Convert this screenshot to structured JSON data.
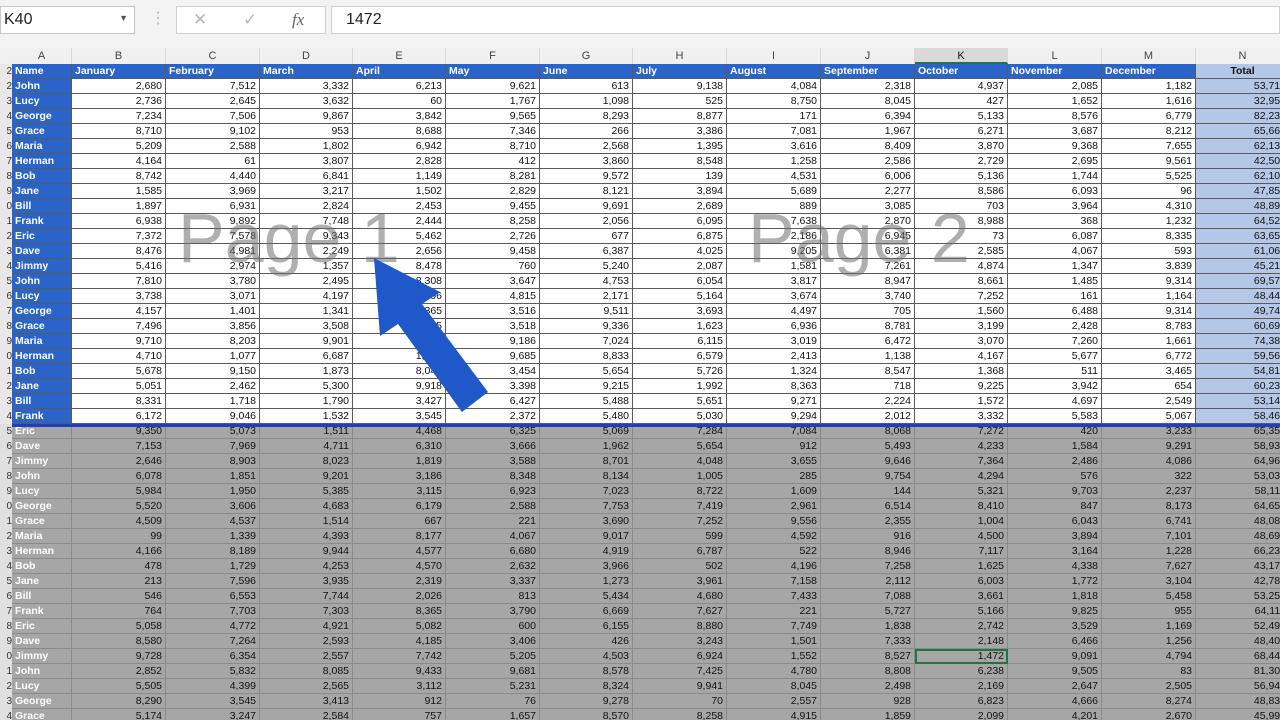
{
  "formula_bar": {
    "name_box": "K40",
    "cancel_glyph": "✕",
    "enter_glyph": "✓",
    "fx_label": "fx",
    "formula": "1472"
  },
  "colors": {
    "header_blue": "#2a64c9",
    "total_blue": "#b4c7e7",
    "gray_area": "#a6a6a6",
    "page_break": "#1f3fbf",
    "arrow": "#1f58c8"
  },
  "icons": {
    "arrow": "arrow-icon",
    "dropdown": "chevron-down-icon"
  },
  "watermarks": [
    "Page 1",
    "Page 2"
  ],
  "columns": [
    "A",
    "B",
    "C",
    "D",
    "E",
    "F",
    "G",
    "H",
    "I",
    "J",
    "K",
    "L",
    "M",
    "N"
  ],
  "active_column": "K",
  "header_row": {
    "row": "2",
    "cells": [
      "Name",
      "January",
      "February",
      "March",
      "April",
      "May",
      "June",
      "July",
      "August",
      "September",
      "October",
      "November",
      "December",
      "Total"
    ]
  },
  "rows": [
    {
      "rn": "2",
      "name": "John",
      "v": [
        "2,680",
        "7,512",
        "3,332",
        "6,213",
        "9,621",
        "613",
        "9,138",
        "4,084",
        "2,318",
        "4,937",
        "2,085",
        "1,182",
        "53,715"
      ]
    },
    {
      "rn": "3",
      "name": "Lucy",
      "v": [
        "2,736",
        "2,645",
        "3,632",
        "60",
        "1,767",
        "1,098",
        "525",
        "8,750",
        "8,045",
        "427",
        "1,652",
        "1,616",
        "32,953"
      ]
    },
    {
      "rn": "4",
      "name": "George",
      "v": [
        "7,234",
        "7,506",
        "9,867",
        "3,842",
        "9,565",
        "8,293",
        "8,877",
        "171",
        "6,394",
        "5,133",
        "8,576",
        "6,779",
        "82,237"
      ]
    },
    {
      "rn": "5",
      "name": "Grace",
      "v": [
        "8,710",
        "9,102",
        "953",
        "8,688",
        "7,346",
        "266",
        "3,386",
        "7,081",
        "1,967",
        "6,271",
        "3,687",
        "8,212",
        "65,669"
      ]
    },
    {
      "rn": "6",
      "name": "Maria",
      "v": [
        "5,209",
        "2,588",
        "1,802",
        "6,942",
        "8,710",
        "2,568",
        "1,395",
        "3,616",
        "8,409",
        "3,870",
        "9,368",
        "7,655",
        "62,132"
      ]
    },
    {
      "rn": "7",
      "name": "Herman",
      "v": [
        "4,164",
        "61",
        "3,807",
        "2,828",
        "412",
        "3,860",
        "8,548",
        "1,258",
        "2,586",
        "2,729",
        "2,695",
        "9,561",
        "42,509"
      ]
    },
    {
      "rn": "8",
      "name": "Bob",
      "v": [
        "8,742",
        "4,440",
        "6,841",
        "1,149",
        "8,281",
        "9,572",
        "139",
        "4,531",
        "6,006",
        "5,136",
        "1,744",
        "5,525",
        "62,106"
      ]
    },
    {
      "rn": "9",
      "name": "Jane",
      "v": [
        "1,585",
        "3,969",
        "3,217",
        "1,502",
        "2,829",
        "8,121",
        "3,894",
        "5,689",
        "2,277",
        "8,586",
        "6,093",
        "96",
        "47,858"
      ]
    },
    {
      "rn": "0",
      "name": "Bill",
      "v": [
        "1,897",
        "6,931",
        "2,824",
        "2,453",
        "9,455",
        "9,691",
        "2,689",
        "889",
        "3,085",
        "703",
        "3,964",
        "4,310",
        "48,891"
      ]
    },
    {
      "rn": "1",
      "name": "Frank",
      "v": [
        "6,938",
        "9,892",
        "7,748",
        "2,444",
        "8,258",
        "2,056",
        "6,095",
        "7,638",
        "2,870",
        "8,988",
        "368",
        "1,232",
        "64,527"
      ]
    },
    {
      "rn": "2",
      "name": "Eric",
      "v": [
        "7,372",
        "7,578",
        "9,343",
        "5,462",
        "2,726",
        "677",
        "6,875",
        "2,186",
        "6,945",
        "73",
        "6,087",
        "8,335",
        "63,659"
      ]
    },
    {
      "rn": "3",
      "name": "Dave",
      "v": [
        "8,476",
        "4,981",
        "2,249",
        "2,656",
        "9,458",
        "6,387",
        "4,025",
        "9,205",
        "6,381",
        "2,585",
        "4,067",
        "593",
        "61,063"
      ]
    },
    {
      "rn": "4",
      "name": "Jimmy",
      "v": [
        "5,416",
        "2,974",
        "1,357",
        "8,478",
        "760",
        "5,240",
        "2,087",
        "1,581",
        "7,261",
        "4,874",
        "1,347",
        "3,839",
        "45,214"
      ]
    },
    {
      "rn": "5",
      "name": "John",
      "v": [
        "7,810",
        "3,780",
        "2,495",
        "8,308",
        "3,647",
        "4,753",
        "6,054",
        "3,817",
        "8,947",
        "8,661",
        "1,485",
        "9,314",
        "69,571"
      ]
    },
    {
      "rn": "6",
      "name": "Lucy",
      "v": [
        "3,738",
        "3,071",
        "4,197",
        "2,296",
        "4,815",
        "2,171",
        "5,164",
        "3,674",
        "3,740",
        "7,252",
        "161",
        "1,164",
        "48,443"
      ]
    },
    {
      "rn": "7",
      "name": "George",
      "v": [
        "4,157",
        "1,401",
        "1,341",
        "7,365",
        "3,516",
        "9,511",
        "3,693",
        "4,497",
        "705",
        "1,560",
        "6,488",
        "9,314",
        "49,748"
      ]
    },
    {
      "rn": "8",
      "name": "Grace",
      "v": [
        "7,496",
        "3,856",
        "3,508",
        "1,335",
        "3,518",
        "9,336",
        "1,623",
        "6,936",
        "8,781",
        "3,199",
        "2,428",
        "8,783",
        "60,699"
      ]
    },
    {
      "rn": "9",
      "name": "Maria",
      "v": [
        "9,710",
        "8,203",
        "9,901",
        "1,112",
        "9,186",
        "7,024",
        "6,115",
        "3,019",
        "6,472",
        "3,070",
        "7,260",
        "1,661",
        "74,382"
      ]
    },
    {
      "rn": "0",
      "name": "Herman",
      "v": [
        "4,710",
        "1,077",
        "6,687",
        "1,225",
        "9,685",
        "8,833",
        "6,579",
        "2,413",
        "1,138",
        "4,167",
        "5,677",
        "6,772",
        "59,561"
      ]
    },
    {
      "rn": "1",
      "name": "Bob",
      "v": [
        "5,678",
        "9,150",
        "1,873",
        "8,041",
        "3,454",
        "5,654",
        "5,726",
        "1,324",
        "8,547",
        "1,368",
        "511",
        "3,465",
        "54,812"
      ]
    },
    {
      "rn": "2",
      "name": "Jane",
      "v": [
        "5,051",
        "2,462",
        "5,300",
        "9,918",
        "3,398",
        "9,215",
        "1,992",
        "8,363",
        "718",
        "9,225",
        "3,942",
        "654",
        "60,238"
      ]
    },
    {
      "rn": "3",
      "name": "Bill",
      "v": [
        "8,331",
        "1,718",
        "1,790",
        "3,427",
        "6,427",
        "5,488",
        "5,651",
        "9,271",
        "2,224",
        "1,572",
        "4,697",
        "2,549",
        "53,145"
      ]
    },
    {
      "rn": "4",
      "name": "Frank",
      "v": [
        "6,172",
        "9,046",
        "1,532",
        "3,545",
        "2,372",
        "5,480",
        "5,030",
        "9,294",
        "2,012",
        "3,332",
        "5,583",
        "5,067",
        "58,465"
      ]
    },
    {
      "rn": "5",
      "name": "Eric",
      "v": [
        "9,350",
        "5,073",
        "1,511",
        "4,468",
        "6,325",
        "5,069",
        "7,284",
        "7,084",
        "8,068",
        "7,272",
        "420",
        "3,233",
        "65,357"
      ]
    },
    {
      "rn": "6",
      "name": "Dave",
      "v": [
        "7,153",
        "7,969",
        "4,711",
        "6,310",
        "3,666",
        "1,962",
        "5,654",
        "912",
        "5,493",
        "4,233",
        "1,584",
        "9,291",
        "58,938"
      ]
    },
    {
      "rn": "7",
      "name": "Jimmy",
      "v": [
        "2,646",
        "8,903",
        "8,023",
        "1,819",
        "3,588",
        "8,701",
        "4,048",
        "3,655",
        "9,646",
        "7,364",
        "2,486",
        "4,086",
        "64,965"
      ]
    },
    {
      "rn": "8",
      "name": "John",
      "v": [
        "6,078",
        "1,851",
        "9,201",
        "3,186",
        "8,348",
        "8,134",
        "1,005",
        "285",
        "9,754",
        "4,294",
        "576",
        "322",
        "53,034"
      ]
    },
    {
      "rn": "9",
      "name": "Lucy",
      "v": [
        "5,984",
        "1,950",
        "5,385",
        "3,115",
        "6,923",
        "7,023",
        "8,722",
        "1,609",
        "144",
        "5,321",
        "9,703",
        "2,237",
        "58,116"
      ]
    },
    {
      "rn": "0",
      "name": "George",
      "v": [
        "5,520",
        "3,606",
        "4,683",
        "6,179",
        "2,588",
        "7,753",
        "7,419",
        "2,961",
        "6,514",
        "8,410",
        "847",
        "8,173",
        "64,653"
      ]
    },
    {
      "rn": "1",
      "name": "Grace",
      "v": [
        "4,509",
        "4,537",
        "1,514",
        "667",
        "221",
        "3,690",
        "7,252",
        "9,556",
        "2,355",
        "1,004",
        "6,043",
        "6,741",
        "48,089"
      ]
    },
    {
      "rn": "2",
      "name": "Maria",
      "v": [
        "99",
        "1,339",
        "4,393",
        "8,177",
        "4,067",
        "9,017",
        "599",
        "4,592",
        "916",
        "4,500",
        "3,894",
        "7,101",
        "48,694"
      ]
    },
    {
      "rn": "3",
      "name": "Herman",
      "v": [
        "4,166",
        "8,189",
        "9,944",
        "4,577",
        "6,680",
        "4,919",
        "6,787",
        "522",
        "8,946",
        "7,117",
        "3,164",
        "1,228",
        "66,239"
      ]
    },
    {
      "rn": "4",
      "name": "Bob",
      "v": [
        "478",
        "1,729",
        "4,253",
        "4,570",
        "2,632",
        "3,966",
        "502",
        "4,196",
        "7,258",
        "1,625",
        "4,338",
        "7,627",
        "43,174"
      ]
    },
    {
      "rn": "5",
      "name": "Jane",
      "v": [
        "213",
        "7,596",
        "3,935",
        "2,319",
        "3,337",
        "1,273",
        "3,961",
        "7,158",
        "2,112",
        "6,003",
        "1,772",
        "3,104",
        "42,783"
      ]
    },
    {
      "rn": "6",
      "name": "Bill",
      "v": [
        "546",
        "6,553",
        "7,744",
        "2,026",
        "813",
        "5,434",
        "4,680",
        "7,433",
        "7,088",
        "3,661",
        "1,818",
        "5,458",
        "53,254"
      ]
    },
    {
      "rn": "7",
      "name": "Frank",
      "v": [
        "764",
        "7,703",
        "7,303",
        "8,365",
        "3,790",
        "6,669",
        "7,627",
        "221",
        "5,727",
        "5,166",
        "9,825",
        "955",
        "64,115"
      ]
    },
    {
      "rn": "8",
      "name": "Eric",
      "v": [
        "5,058",
        "4,772",
        "4,921",
        "5,082",
        "600",
        "6,155",
        "8,880",
        "7,749",
        "1,838",
        "2,742",
        "3,529",
        "1,169",
        "52,495"
      ]
    },
    {
      "rn": "9",
      "name": "Dave",
      "v": [
        "8,580",
        "7,264",
        "2,593",
        "4,185",
        "3,406",
        "426",
        "3,243",
        "1,501",
        "7,333",
        "2,148",
        "6,466",
        "1,256",
        "48,401"
      ]
    },
    {
      "rn": "0",
      "name": "Jimmy",
      "v": [
        "9,728",
        "6,354",
        "2,557",
        "7,742",
        "5,205",
        "4,503",
        "6,924",
        "1,552",
        "8,527",
        "1,472",
        "9,091",
        "4,794",
        "68,449"
      ]
    },
    {
      "rn": "1",
      "name": "John",
      "v": [
        "2,852",
        "5,832",
        "8,085",
        "9,433",
        "9,681",
        "8,578",
        "7,425",
        "4,780",
        "8,808",
        "6,238",
        "9,505",
        "83",
        "81,300"
      ]
    },
    {
      "rn": "2",
      "name": "Lucy",
      "v": [
        "5,505",
        "4,399",
        "2,565",
        "3,112",
        "5,231",
        "8,324",
        "9,941",
        "8,045",
        "2,498",
        "2,169",
        "2,647",
        "2,505",
        "56,941"
      ]
    },
    {
      "rn": "3",
      "name": "George",
      "v": [
        "8,290",
        "3,545",
        "3,413",
        "912",
        "76",
        "9,278",
        "70",
        "2,557",
        "928",
        "6,823",
        "4,666",
        "8,274",
        "48,832"
      ]
    },
    {
      "rn": "4",
      "name": "Grace",
      "v": [
        "5,174",
        "3,247",
        "2,584",
        "757",
        "1,657",
        "8,570",
        "8,258",
        "4,915",
        "1,859",
        "2,099",
        "4,201",
        "2,670",
        "45,991"
      ]
    }
  ]
}
